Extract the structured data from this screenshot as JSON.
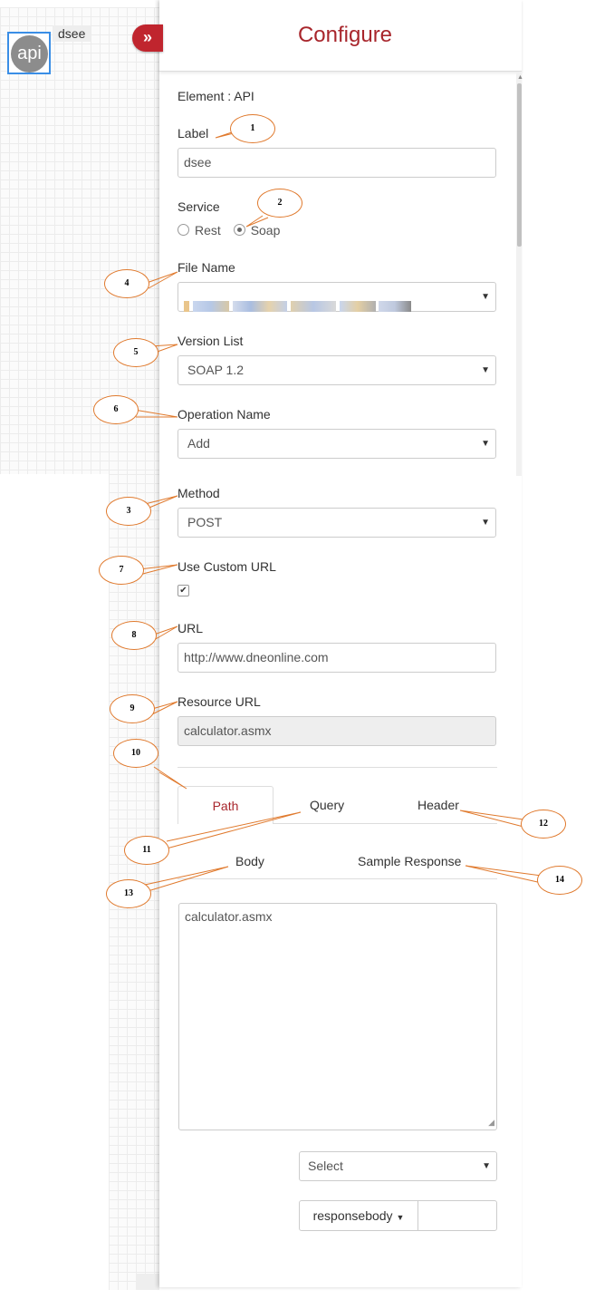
{
  "canvas": {
    "node_icon_text": "api",
    "node_label": "dsee"
  },
  "panel": {
    "title": "Configure",
    "element_line": "Element : API"
  },
  "form": {
    "label": {
      "label": "Label",
      "value": "dsee"
    },
    "service": {
      "label": "Service",
      "options": [
        "Rest",
        "Soap"
      ],
      "selected": "Soap"
    },
    "file_name": {
      "label": "File Name"
    },
    "version_list": {
      "label": "Version List",
      "value": "SOAP 1.2"
    },
    "operation_name": {
      "label": "Operation Name",
      "value": "Add"
    },
    "method": {
      "label": "Method",
      "value": "POST"
    },
    "use_custom_url": {
      "label": "Use Custom URL",
      "checked": true,
      "check_glyph": "✔"
    },
    "url": {
      "label": "URL",
      "value": "http://www.dneonline.com"
    },
    "resource_url": {
      "label": "Resource URL",
      "value": "calculator.asmx"
    }
  },
  "tabs": {
    "row1": [
      "Path",
      "Query",
      "Header"
    ],
    "row2": [
      "Body",
      "Sample Response"
    ],
    "active": "Path"
  },
  "body_text": "calculator.asmx",
  "select_placeholder": "Select",
  "response_dropdown": "responsebody",
  "annotations": [
    "1",
    "2",
    "4",
    "5",
    "6",
    "3",
    "7",
    "8",
    "9",
    "10",
    "11",
    "12",
    "13",
    "14"
  ],
  "colors": {
    "accent": "#a8262c",
    "collapse_button": "#c0252e",
    "node_border": "#3a8ee6",
    "annotation_stroke": "#e07a2e"
  },
  "icons": {
    "collapse": "double-chevron-right-icon",
    "select_caret": "caret-down-icon"
  }
}
